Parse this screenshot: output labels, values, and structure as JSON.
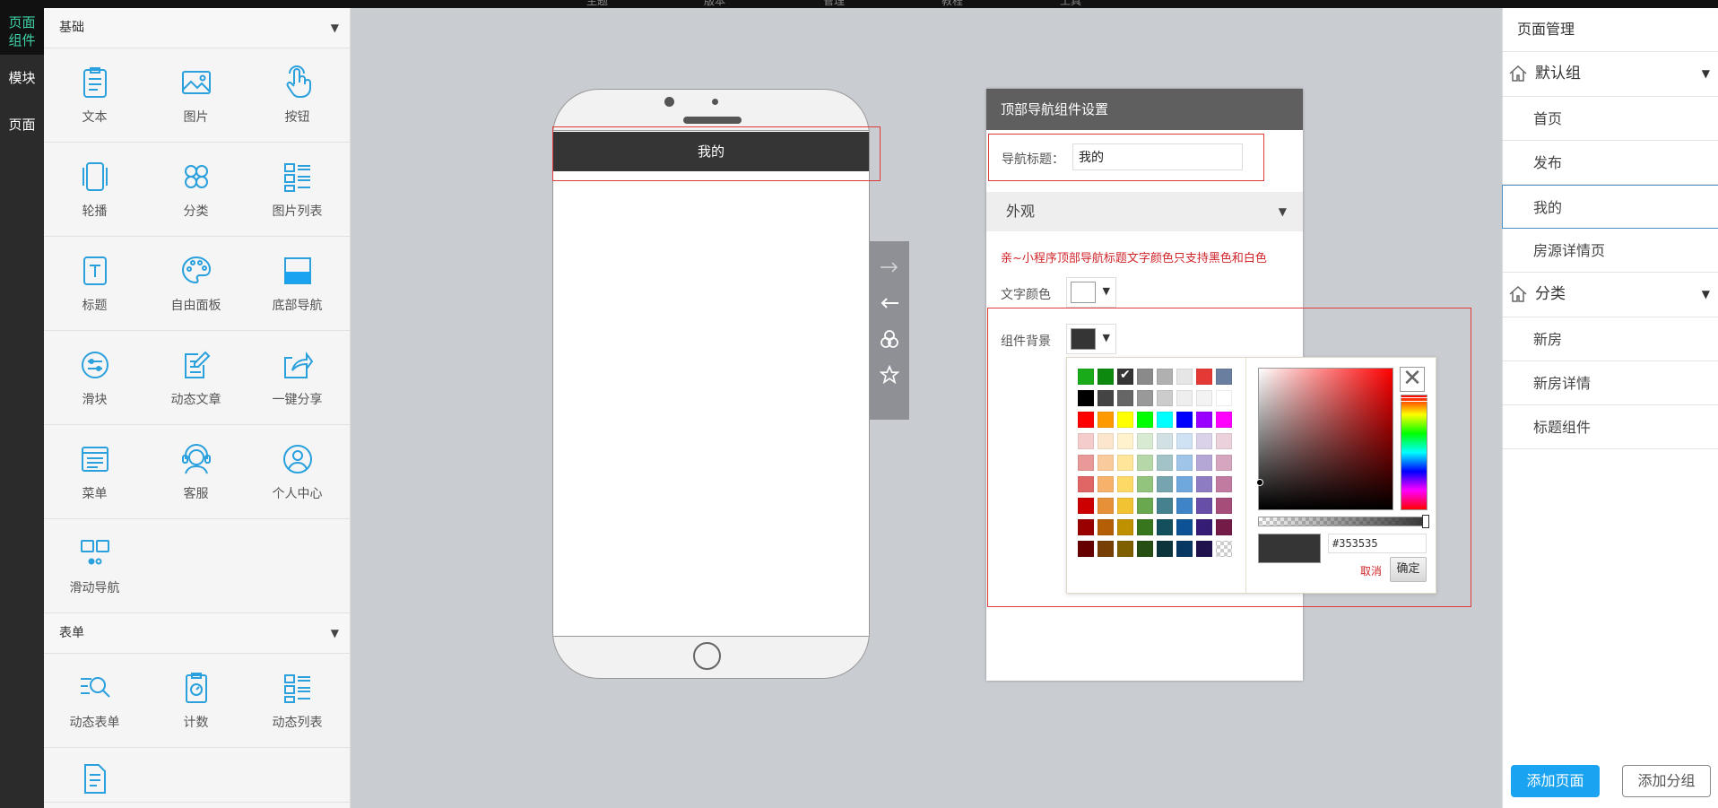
{
  "top_menu": [
    "主题",
    "版本",
    "管理",
    "教程",
    "工具"
  ],
  "rail": [
    {
      "label": "页面\n组件",
      "active": true
    },
    {
      "label": "模块",
      "active": false
    },
    {
      "label": "页面",
      "active": false
    }
  ],
  "components": {
    "basic_title": "基础",
    "basic_items": [
      "文本",
      "图片",
      "按钮",
      "轮播",
      "分类",
      "图片列表",
      "标题",
      "自由面板",
      "底部导航",
      "滑块",
      "动态文章",
      "一键分享",
      "菜单",
      "客服",
      "个人中心",
      "滑动导航"
    ],
    "form_title": "表单",
    "form_items": [
      "动态表单",
      "计数",
      "动态列表"
    ]
  },
  "phone": {
    "nav_title": "我的"
  },
  "settings": {
    "header": "顶部导航组件设置",
    "nav_title_label": "导航标题：",
    "nav_title_value": "我的",
    "appearance": "外观",
    "tip": "亲~小程序顶部导航标题文字颜色只支持黑色和白色",
    "text_color_label": "文字颜色",
    "text_color": "#ffffff",
    "bg_label": "组件背景",
    "bg_color": "#353535"
  },
  "picker": {
    "hex": "#353535",
    "cancel": "取消",
    "ok": "确定",
    "palette": [
      [
        "#1aab1a",
        "#0d8a0d",
        "#353535",
        "#8a8a8a",
        "#b0b0b0",
        "#e6e6e6",
        "#e53935",
        "#6a7fa0"
      ],
      [
        "#000000",
        "#444444",
        "#666666",
        "#999999",
        "#cccccc",
        "#eeeeee",
        "#f3f3f3",
        "#ffffff"
      ],
      [
        "#ff0000",
        "#ff9900",
        "#ffff00",
        "#00ff00",
        "#00ffff",
        "#0000ff",
        "#9900ff",
        "#ff00ff"
      ],
      [
        "#f4cccc",
        "#fce5cd",
        "#fff2cc",
        "#d9ead3",
        "#d0e0e3",
        "#cfe2f3",
        "#d9d2e9",
        "#ead1dc"
      ],
      [
        "#ea9999",
        "#f9cb9c",
        "#ffe599",
        "#b6d7a8",
        "#a2c4c9",
        "#9fc5e8",
        "#b4a7d6",
        "#d5a6bd"
      ],
      [
        "#e06666",
        "#f6b26b",
        "#ffd966",
        "#93c47d",
        "#76a5af",
        "#6fa8dc",
        "#8e7cc3",
        "#c27ba0"
      ],
      [
        "#cc0000",
        "#e69138",
        "#f1c232",
        "#6aa84f",
        "#45818e",
        "#3d85c6",
        "#674ea7",
        "#a64d79"
      ],
      [
        "#990000",
        "#b45f06",
        "#bf9000",
        "#38761d",
        "#134f5c",
        "#0b5394",
        "#351c75",
        "#741b47"
      ],
      [
        "#660000",
        "#783f04",
        "#7f6000",
        "#274e13",
        "#0c343d",
        "#073763",
        "#20124d",
        "transparent"
      ]
    ]
  },
  "page_manager": {
    "title": "页面管理",
    "groups": [
      {
        "name": "默认组",
        "pages": [
          "首页",
          "发布",
          "我的",
          "房源详情页"
        ],
        "selected": "我的"
      },
      {
        "name": "分类",
        "pages": [
          "新房",
          "新房详情",
          "标题组件"
        ]
      }
    ],
    "add_page": "添加页面",
    "add_group": "添加分组"
  }
}
